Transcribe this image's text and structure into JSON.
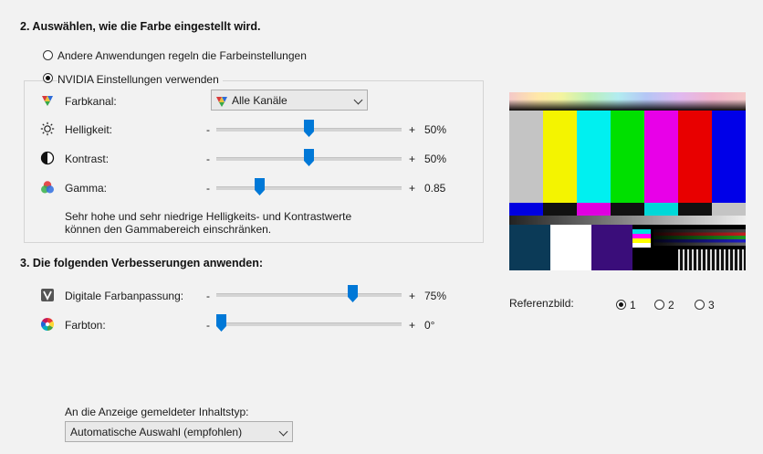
{
  "section2": {
    "heading": "2. Auswählen, wie die Farbe eingestellt wird.",
    "option_other": "Andere Anwendungen regeln die Farbeinstellungen",
    "option_nvidia": "NVIDIA Einstellungen verwenden",
    "selected_option": "nvidia",
    "farbkanal": {
      "label": "Farbkanal:",
      "value": "Alle Kanäle",
      "icon": "color-channel-icon"
    },
    "helligkeit": {
      "label": "Helligkeit:",
      "minus": "-",
      "plus": "+",
      "value": "50%",
      "level": 0.5,
      "icon": "sun-icon"
    },
    "kontrast": {
      "label": "Kontrast:",
      "minus": "-",
      "plus": "+",
      "value": "50%",
      "level": 0.5,
      "icon": "contrast-icon"
    },
    "gamma": {
      "label": "Gamma:",
      "minus": "-",
      "plus": "+",
      "value": "0.85",
      "level": 0.22,
      "icon": "gamma-rgb-icon"
    },
    "note_line1": "Sehr hohe und sehr niedrige Helligkeits- und Kontrastwerte",
    "note_line2": "können den Gammabereich einschränken."
  },
  "section3": {
    "heading": "3. Die folgenden Verbesserungen anwenden:",
    "vibrance": {
      "label": "Digitale Farbanpassung:",
      "minus": "-",
      "plus": "+",
      "value": "75%",
      "level": 0.75,
      "icon": "digital-vibrance-icon"
    },
    "hue": {
      "label": "Farbton:",
      "minus": "-",
      "plus": "+",
      "value": "0°",
      "level": 0.0,
      "icon": "hue-wheel-icon"
    }
  },
  "reference": {
    "label": "Referenzbild:",
    "options": [
      "1",
      "2",
      "3"
    ],
    "selected": "1"
  },
  "content_type": {
    "label": "An die Anzeige gemeldeter Inhaltstyp:",
    "value": "Automatische Auswahl (empfohlen)"
  },
  "colors": {
    "accent": "#0078d7",
    "background": "#f2f2f2"
  }
}
